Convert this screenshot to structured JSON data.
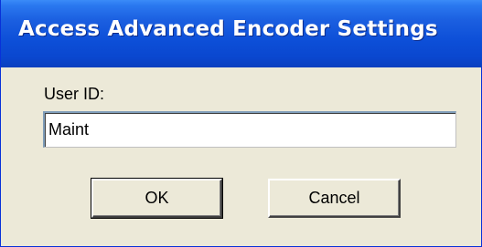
{
  "window": {
    "title": "Access Advanced Encoder Settings"
  },
  "form": {
    "user_id_label": "User ID:",
    "user_id_value": "Maint"
  },
  "buttons": {
    "ok_label": "OK",
    "cancel_label": "Cancel"
  },
  "colors": {
    "titlebar": "#0a47cf",
    "dialog_background": "#ece9d8",
    "title_text": "#ffffff"
  }
}
